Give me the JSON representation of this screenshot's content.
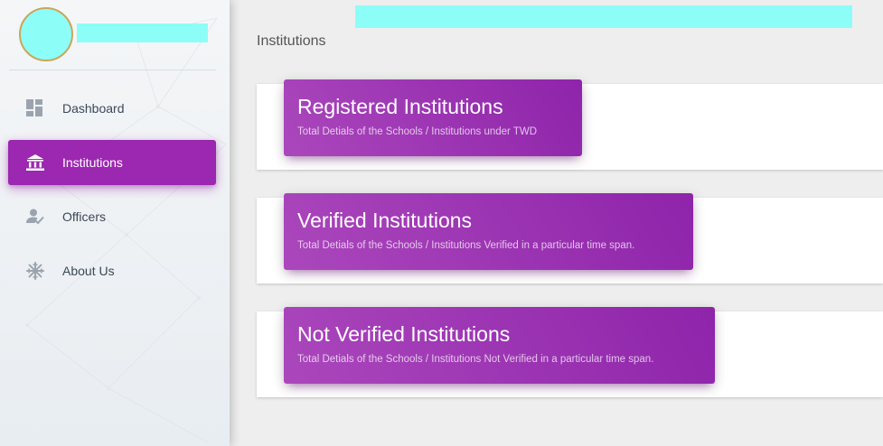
{
  "sidebar": {
    "nav": [
      {
        "label": "Dashboard",
        "icon": "dashboard-icon"
      },
      {
        "label": "Institutions",
        "icon": "institution-icon",
        "active": true
      },
      {
        "label": "Officers",
        "icon": "officer-icon"
      },
      {
        "label": "About Us",
        "icon": "snowflake-icon"
      }
    ]
  },
  "page": {
    "title": "Institutions"
  },
  "cards": [
    {
      "title": "Registered Institutions",
      "subtitle": "Total Detials of the Schools / Institutions under TWD"
    },
    {
      "title": "Verified Institutions",
      "subtitle": "Total Detials of the Schools / Institutions Verified in a particular time span."
    },
    {
      "title": "Not Verified Institutions",
      "subtitle": "Total Detials of the Schools / Institutions Not Verified in a particular time span."
    }
  ],
  "colors": {
    "accent": "#9c27b0",
    "redacted_fill": "#8dfdf8",
    "sidebar_text": "#3c4858",
    "icon_gray": "#9ba4ae"
  }
}
